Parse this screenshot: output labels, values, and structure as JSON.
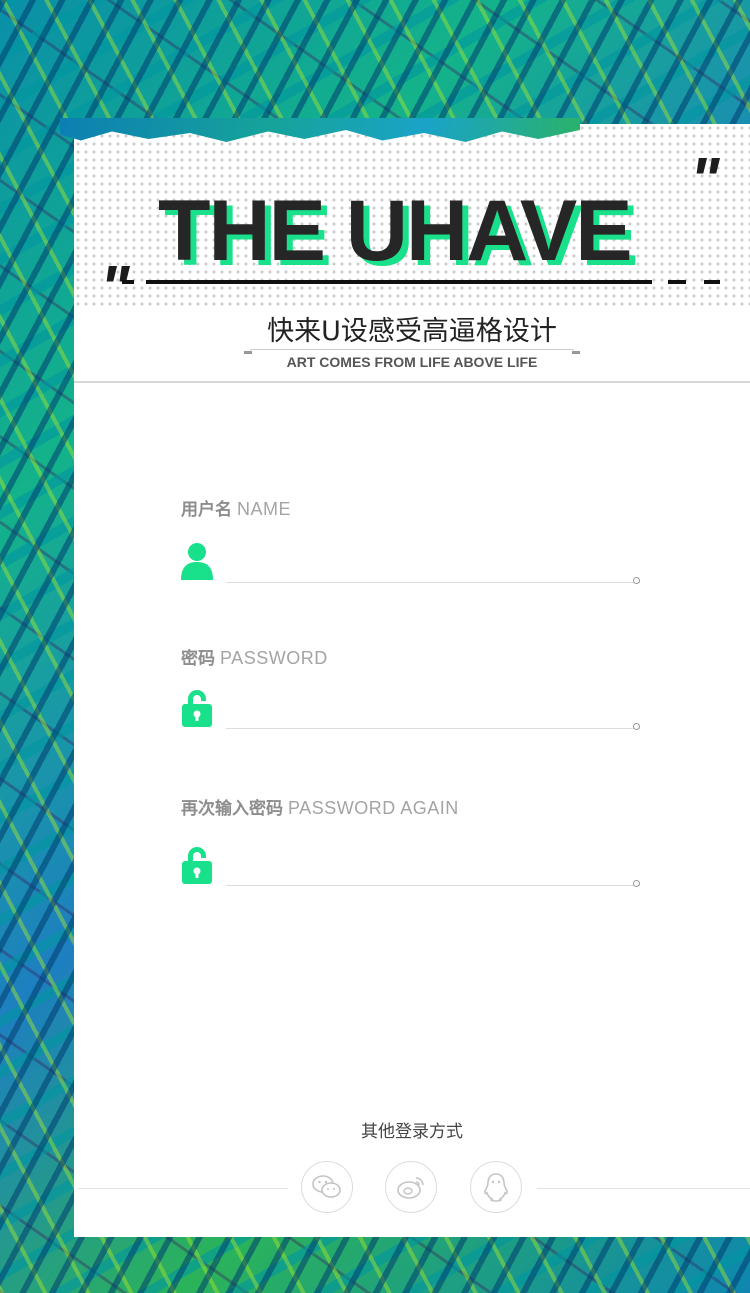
{
  "header": {
    "title": "THE UHAVE",
    "open_quote": "\"",
    "close_quote": "\"",
    "slogan": "快来U设感受高逼格设计",
    "subtitle": "ART COMES FROM LIFE ABOVE LIFE"
  },
  "form": {
    "username": {
      "label_cn": "用户名",
      "label_en": "NAME",
      "icon": "user-icon",
      "value": ""
    },
    "password": {
      "label_cn": "密码",
      "label_en": "PASSWORD",
      "icon": "lock-icon",
      "value": ""
    },
    "password_again": {
      "label_cn": "再次输入密码",
      "label_en": "PASSWORD AGAIN",
      "icon": "lock-icon",
      "value": ""
    }
  },
  "other_login": {
    "label": "其他登录方式",
    "methods": [
      {
        "name": "wechat",
        "icon": "wechat-icon"
      },
      {
        "name": "weibo",
        "icon": "weibo-icon"
      },
      {
        "name": "qq",
        "icon": "qq-icon"
      }
    ]
  },
  "colors": {
    "accent": "#19e08a",
    "title": "#262626",
    "label": "#9a9a9a"
  }
}
